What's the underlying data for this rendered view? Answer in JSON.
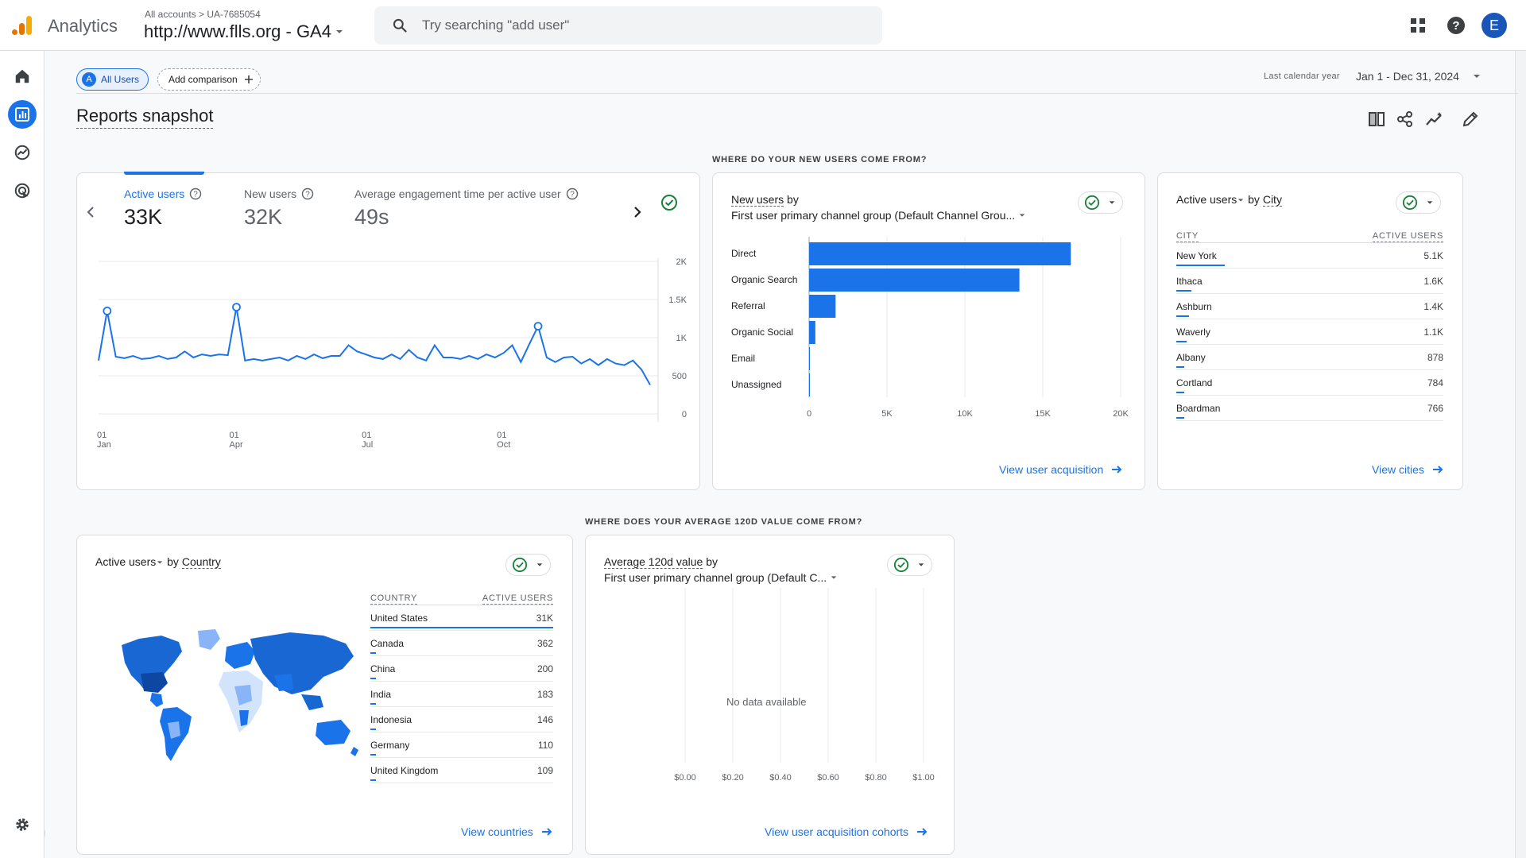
{
  "app": {
    "name": "Analytics",
    "account_crumb": "All accounts > UA-7685054",
    "property": "http://www.flls.org - GA4",
    "search_placeholder": "Try searching \"add user\"",
    "avatar_letter": "E"
  },
  "header": {
    "comparison_chip": {
      "badge": "A",
      "label": "All Users"
    },
    "add_comparison": "Add comparison",
    "date_caption": "Last calendar year",
    "date_range": "Jan 1 - Dec 31, 2024",
    "title": "Reports snapshot"
  },
  "sections": {
    "new_users_source": "WHERE DO YOUR NEW USERS COME FROM?",
    "value_source": "WHERE DOES YOUR AVERAGE 120D VALUE COME FROM?"
  },
  "overview": {
    "metrics": [
      {
        "label": "Active users",
        "value": "33K",
        "active": true
      },
      {
        "label": "New users",
        "value": "32K",
        "active": false
      },
      {
        "label": "Average engagement time per active user",
        "value": "49s",
        "active": false
      }
    ]
  },
  "acquisition": {
    "heading_metric": "New users",
    "heading_by": "by",
    "heading_dimension": "First user primary channel group (Default Channel Grou...",
    "link": "View user acquisition"
  },
  "city_card": {
    "heading_metric": "Active users",
    "heading_by": "by",
    "heading_dimension": "City",
    "columns": [
      "CITY",
      "ACTIVE USERS"
    ],
    "rows": [
      {
        "name": "New York",
        "value": "5.1K",
        "fraction": 1.0
      },
      {
        "name": "Ithaca",
        "value": "1.6K",
        "fraction": 0.31
      },
      {
        "name": "Ashburn",
        "value": "1.4K",
        "fraction": 0.27
      },
      {
        "name": "Waverly",
        "value": "1.1K",
        "fraction": 0.22
      },
      {
        "name": "Albany",
        "value": "878",
        "fraction": 0.17
      },
      {
        "name": "Cortland",
        "value": "784",
        "fraction": 0.15
      },
      {
        "name": "Boardman",
        "value": "766",
        "fraction": 0.15
      }
    ],
    "link": "View cities"
  },
  "country_card": {
    "heading_metric": "Active users",
    "heading_by": "by",
    "heading_dimension": "Country",
    "columns": [
      "COUNTRY",
      "ACTIVE USERS"
    ],
    "rows": [
      {
        "name": "United States",
        "value": "31K",
        "fraction": 1.0
      },
      {
        "name": "Canada",
        "value": "362",
        "fraction": 0.012
      },
      {
        "name": "China",
        "value": "200",
        "fraction": 0.0065
      },
      {
        "name": "India",
        "value": "183",
        "fraction": 0.006
      },
      {
        "name": "Indonesia",
        "value": "146",
        "fraction": 0.005
      },
      {
        "name": "Germany",
        "value": "110",
        "fraction": 0.0036
      },
      {
        "name": "United Kingdom",
        "value": "109",
        "fraction": 0.0035
      }
    ],
    "link": "View countries"
  },
  "value_card": {
    "heading_metric": "Average 120d value",
    "heading_by": "by",
    "heading_dimension": "First user primary channel group (Default C...",
    "no_data": "No data available",
    "link": "View user acquisition cohorts"
  },
  "colors": {
    "accent": "#1a73e8",
    "success": "#188038",
    "line": "#1a73e8"
  },
  "icons": [
    "search-icon",
    "apps-icon",
    "help-icon",
    "home-icon",
    "reports-icon",
    "explore-icon",
    "advertising-icon",
    "gear-icon",
    "expand-icon",
    "compare-icon",
    "share-icon",
    "insights-icon",
    "edit-icon",
    "check-circle-icon",
    "chevron-down-icon",
    "chevron-left-icon",
    "chevron-right-icon",
    "arrow-right-icon",
    "plus-icon"
  ],
  "chart_data": [
    {
      "type": "line",
      "series": [
        {
          "name": "Active users",
          "values": [
            700,
            1350,
            750,
            730,
            760,
            720,
            730,
            760,
            720,
            740,
            820,
            740,
            780,
            760,
            780,
            770,
            1400,
            700,
            720,
            700,
            720,
            740,
            700,
            760,
            720,
            780,
            730,
            760,
            760,
            900,
            820,
            780,
            740,
            720,
            780,
            720,
            840,
            740,
            700,
            900,
            740,
            740,
            720,
            760,
            720,
            780,
            740,
            800,
            900,
            680,
            920,
            1150,
            740,
            680,
            740,
            750,
            660,
            720,
            640,
            720,
            660,
            640,
            700,
            580,
            380
          ]
        }
      ],
      "x_ticks": [
        {
          "day": "01",
          "month": "Jan"
        },
        {
          "day": "01",
          "month": "Apr"
        },
        {
          "day": "01",
          "month": "Jul"
        },
        {
          "day": "01",
          "month": "Oct"
        }
      ],
      "y_ticks": [
        "2K",
        "1.5K",
        "1K",
        "500",
        "0"
      ],
      "ylim": [
        0,
        2000
      ],
      "grid": true
    },
    {
      "type": "bar",
      "orientation": "horizontal",
      "categories": [
        "Direct",
        "Organic Search",
        "Referral",
        "Organic Social",
        "Email",
        "Unassigned"
      ],
      "values": [
        16800,
        13500,
        1700,
        400,
        30,
        20
      ],
      "x_ticks": [
        "0",
        "5K",
        "10K",
        "15K",
        "20K"
      ],
      "xlim": [
        0,
        20000
      ],
      "grid": true
    },
    {
      "type": "bar",
      "orientation": "vertical",
      "categories": [],
      "values": [],
      "y_ticks": [
        "$0.00",
        "$0.20",
        "$0.40",
        "$0.60",
        "$0.80",
        "$1.00"
      ],
      "grid": true
    }
  ]
}
